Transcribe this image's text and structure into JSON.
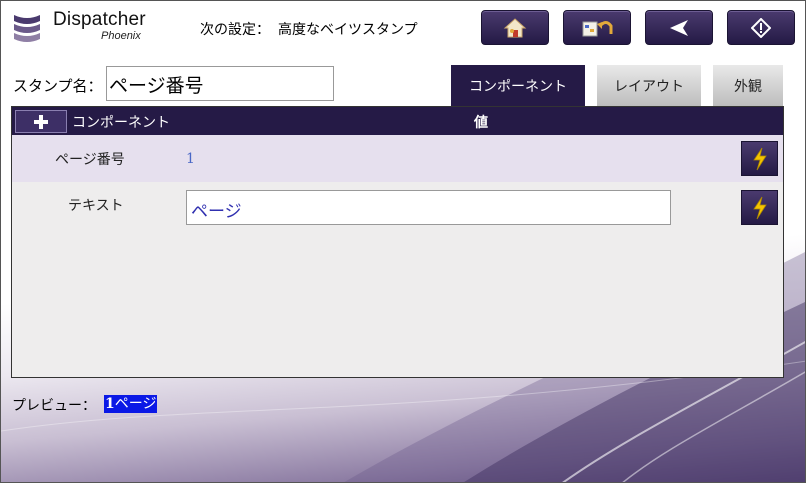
{
  "header": {
    "logo_title": "Dispatcher",
    "logo_subtitle": "Phoenix",
    "next_setting_label": "次の設定：",
    "next_setting_value": "高度なベイツスタンプ",
    "buttons": [
      {
        "name": "home-button",
        "icon": "home-icon"
      },
      {
        "name": "workflow-edit-button",
        "icon": "workflow-undo-icon"
      },
      {
        "name": "back-button",
        "icon": "back-arrow-icon"
      },
      {
        "name": "start-button",
        "icon": "diamond-start-icon"
      }
    ]
  },
  "stamp": {
    "label": "スタンプ名：",
    "value": "ページ番号"
  },
  "tabs": [
    {
      "label": "コンポーネント",
      "active": true
    },
    {
      "label": "レイアウト",
      "active": false
    },
    {
      "label": "外観",
      "active": false
    }
  ],
  "table": {
    "add_symbol": "+",
    "col_component": "コンポーネント",
    "col_value": "値",
    "rows": [
      {
        "component": "ページ番号",
        "value": "1"
      },
      {
        "component": "テキスト",
        "value": "ページ"
      }
    ]
  },
  "preview": {
    "label": "プレビュー：",
    "number": "1",
    "text": "ページ"
  },
  "colors": {
    "accent_dark": "#251a46",
    "bolt_yellow": "#f5c400",
    "preview_highlight": "#0a18e6",
    "number_blue": "#4a68c6"
  }
}
